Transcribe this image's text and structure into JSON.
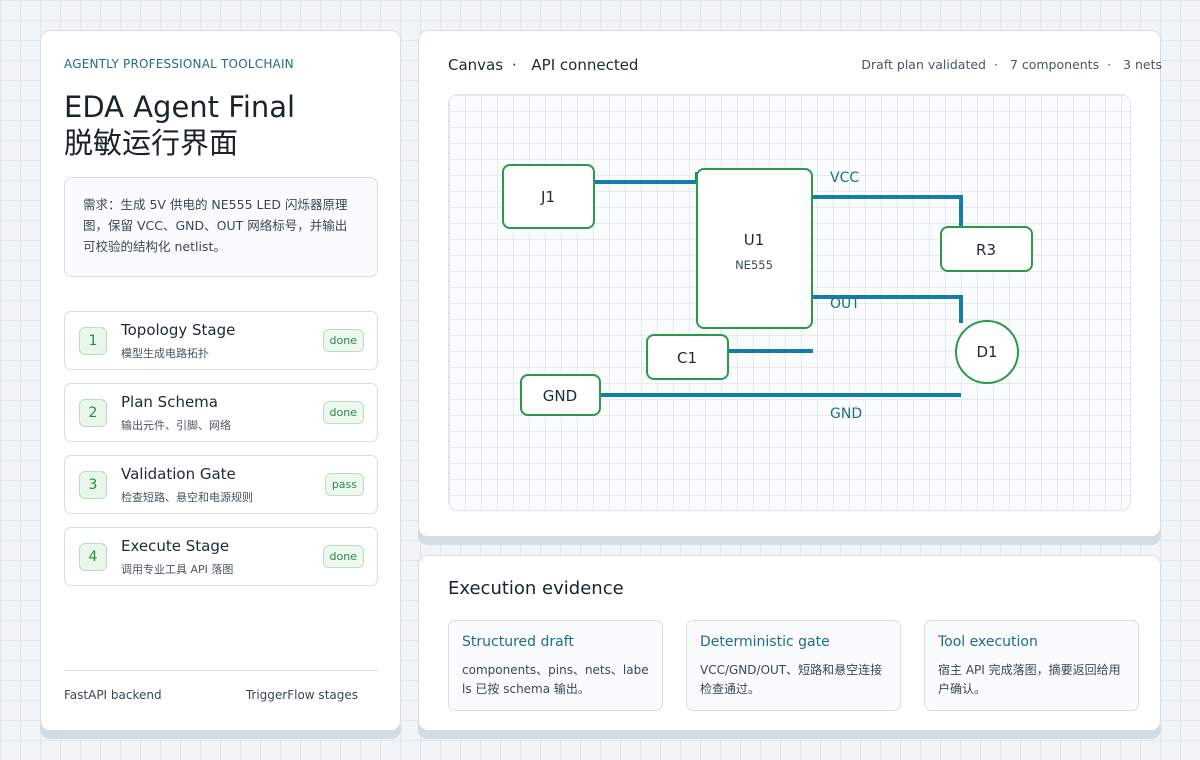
{
  "left": {
    "brand": "AGENTLY PROFESSIONAL TOOLCHAIN",
    "title_line1": "EDA Agent Final",
    "title_line2": "脱敏运行界面",
    "request": "需求：生成 5V 供电的 NE555 LED 闪烁器原理图，保留 VCC、GND、OUT 网络标号，并输出可校验的结构化 netlist。",
    "stages": [
      {
        "num": "1",
        "name": "Topology Stage",
        "sub": "模型生成电路拓扑",
        "status": "done"
      },
      {
        "num": "2",
        "name": "Plan Schema",
        "sub": "输出元件、引脚、网络",
        "status": "done"
      },
      {
        "num": "3",
        "name": "Validation Gate",
        "sub": "检查短路、悬空和电源规则",
        "status": "pass"
      },
      {
        "num": "4",
        "name": "Execute Stage",
        "sub": "调用专业工具 API 落图",
        "status": "done"
      }
    ],
    "footer_left": "FastAPI backend",
    "footer_right": "TriggerFlow stages"
  },
  "canvas": {
    "label": "Canvas",
    "separator": "·",
    "api_status": "API connected",
    "stats": [
      "Draft plan validated",
      "7 components",
      "3 nets"
    ],
    "components": {
      "j1": "J1",
      "u1": "U1",
      "u1_part": "NE555",
      "r3": "R3",
      "c1": "C1",
      "d1": "D1",
      "gnd": "GND"
    },
    "nets": {
      "vcc": "VCC",
      "out": "OUT",
      "gnd": "GND"
    },
    "colors": {
      "component_stroke": "#2a9a47",
      "wire": "#137fa8",
      "net_label": "#1a6f91"
    }
  },
  "evidence": {
    "title": "Execution evidence",
    "cards": [
      {
        "title": "Structured draft",
        "body": "components、pins、nets、labels 已按 schema 输出。"
      },
      {
        "title": "Deterministic gate",
        "body": "VCC/GND/OUT、短路和悬空连接检查通过。"
      },
      {
        "title": "Tool execution",
        "body": "宿主 API 完成落图，摘要返回给用户确认。"
      }
    ]
  }
}
